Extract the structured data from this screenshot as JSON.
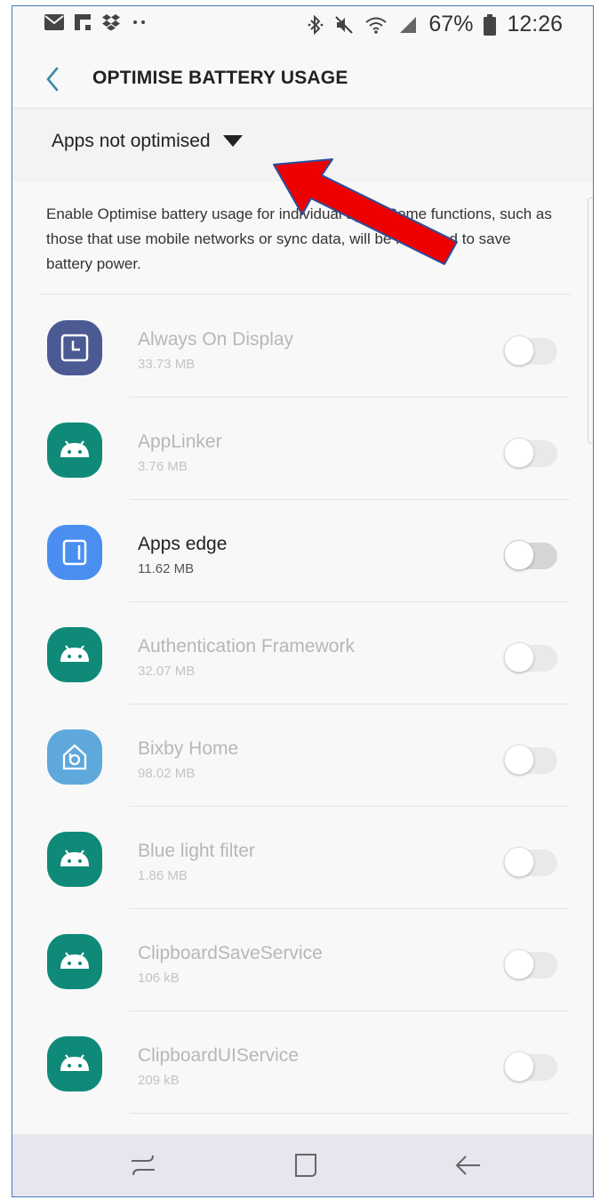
{
  "status_bar": {
    "left_icons": [
      "mail-icon",
      "flipboard-icon",
      "dropbox-icon",
      "more-dots-icon"
    ],
    "right_icons": [
      "bluetooth-icon",
      "mute-icon",
      "wifi-icon",
      "signal-icon"
    ],
    "battery": "67%",
    "time": "12:26"
  },
  "toolbar": {
    "title": "OPTIMISE BATTERY USAGE"
  },
  "filter": {
    "selected": "Apps not optimised"
  },
  "description": "Enable Optimise battery usage for individual apps. Some functions, such as those that use mobile networks or sync data, will be restricted to save battery power.",
  "apps": [
    {
      "name": "Always On Display",
      "size": "33.73 MB",
      "icon": "always-on-display-icon",
      "icon_color": "#4c5a93"
    },
    {
      "name": "AppLinker",
      "size": "3.76 MB",
      "icon": "android-icon",
      "icon_color": "#0f8a78"
    },
    {
      "name": "Apps edge",
      "size": "11.62 MB",
      "icon": "apps-edge-icon",
      "icon_color": "#4a8ff0"
    },
    {
      "name": "Authentication Framework",
      "size": "32.07 MB",
      "icon": "android-icon",
      "icon_color": "#0f8a78"
    },
    {
      "name": "Bixby Home",
      "size": "98.02 MB",
      "icon": "bixby-home-icon",
      "icon_color": "#5ea8db"
    },
    {
      "name": "Blue light filter",
      "size": "1.86 MB",
      "icon": "android-icon",
      "icon_color": "#0f8a78"
    },
    {
      "name": "ClipboardSaveService",
      "size": "106 kB",
      "icon": "android-icon",
      "icon_color": "#0f8a78"
    },
    {
      "name": "ClipboardUIService",
      "size": "209 kB",
      "icon": "android-icon",
      "icon_color": "#0f8a78"
    }
  ],
  "nav_bar": [
    "recents-icon",
    "home-icon",
    "back-icon"
  ],
  "annotation_arrow_color": "#ee0000"
}
